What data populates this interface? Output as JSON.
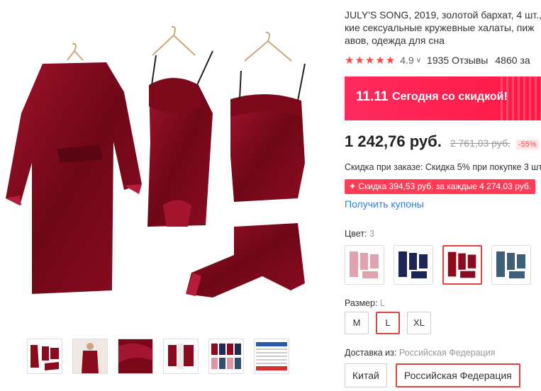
{
  "product": {
    "title_lines": [
      "JULY'S SONG, 2019, золотой бархат, 4 шт.,",
      "кие сексуальные кружевные халаты, пиж",
      "авов, одежда для сна"
    ],
    "stars": "★★★★★",
    "rating": "4.9",
    "reviews": "1935 Отзывы",
    "orders": "4860 за"
  },
  "banner": {
    "badge": "11.11",
    "text": "Сегодня со скидкой!"
  },
  "price": {
    "current": "1 242,76 руб.",
    "old": "2 761,03 руб.",
    "discount": "-55%"
  },
  "order_discount": "Скидка при заказе: Скидка 5% при покупке 3 шт",
  "coupon_badge": "✦ Скидка 394,53 руб. за каждые 4 274,03 руб.",
  "get_coupons": "Получить купоны",
  "color": {
    "label": "Цвет:",
    "value": "3",
    "selected_index": 2,
    "options": [
      "pink",
      "navy",
      "burgundy",
      "teal"
    ]
  },
  "size": {
    "label": "Размер:",
    "value": "L",
    "options": [
      "M",
      "L",
      "XL"
    ],
    "selected": "L"
  },
  "shipping": {
    "label": "Доставка из:",
    "value": "Российская Федерация",
    "options": [
      "Китай",
      "Российская Федерация"
    ],
    "selected": "Российская Федерация"
  },
  "colors": {
    "accent": "#ff4747",
    "link": "#2e7fd6",
    "selected_border": "#e0433d",
    "velvet": "#8b0a1e"
  }
}
